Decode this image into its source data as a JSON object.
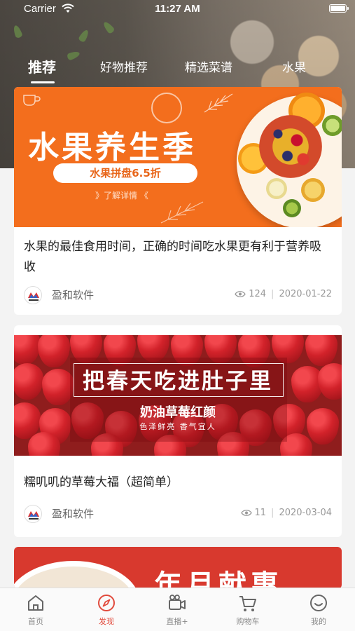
{
  "status_bar": {
    "carrier": "Carrier",
    "time": "11:27 AM"
  },
  "tabs": [
    {
      "label": "推荐",
      "active": true
    },
    {
      "label": "好物推荐",
      "active": false
    },
    {
      "label": "精选菜谱",
      "active": false
    },
    {
      "label": "水果",
      "active": false
    }
  ],
  "feed": [
    {
      "banner": {
        "title": "水果养生季",
        "pill": "水果拼盘6.5折",
        "more": "》了解详情 《"
      },
      "title": "水果的最佳食用时间，正确的时间吃水果更有利于营养吸收",
      "author": "盈和软件",
      "views": "124",
      "date": "2020-01-22"
    },
    {
      "banner": {
        "title": "把春天吃进肚子里",
        "subtitle": "奶油草莓红颜",
        "tagline": "色泽鲜亮 香气宜人"
      },
      "title": "糯叽叽的草莓大福（超简单）",
      "author": "盈和软件",
      "views": "11",
      "date": "2020-03-04"
    },
    {
      "banner": {
        "title": "年月献惠"
      }
    }
  ],
  "tabbar": [
    {
      "label": "首页",
      "icon": "home-icon",
      "active": false
    },
    {
      "label": "发现",
      "icon": "compass-icon",
      "active": true
    },
    {
      "label": "直播+",
      "icon": "video-camera-icon",
      "active": false
    },
    {
      "label": "购物车",
      "icon": "cart-icon",
      "active": false
    },
    {
      "label": "我的",
      "icon": "smiley-icon",
      "active": false
    }
  ],
  "colors": {
    "accent": "#e14a3c",
    "banner_orange": "#f36e1d"
  }
}
